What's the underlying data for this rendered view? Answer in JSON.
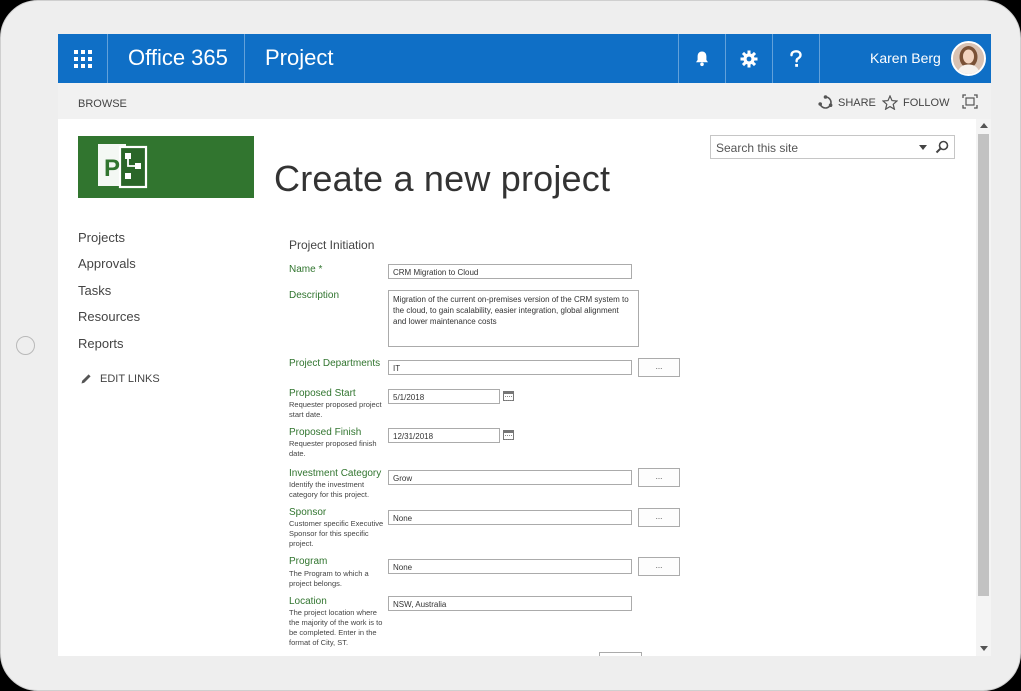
{
  "suitebar": {
    "brand": "Office 365",
    "app": "Project",
    "user": "Karen Berg",
    "icons": [
      "app-launcher-icon",
      "bell-icon",
      "gear-icon",
      "help-icon"
    ]
  },
  "ribbon": {
    "browse": "BROWSE",
    "share": "SHARE",
    "follow": "FOLLOW"
  },
  "search": {
    "placeholder": "Search this site"
  },
  "page": {
    "title": "Create a new project"
  },
  "quicklaunch": {
    "items": [
      "Projects",
      "Approvals",
      "Tasks",
      "Resources",
      "Reports"
    ],
    "edit_links": "EDIT LINKS"
  },
  "form": {
    "section": "Project Initiation",
    "ellipsis": "...",
    "fields": {
      "name": {
        "label": "Name *",
        "value": "CRM Migration to Cloud"
      },
      "description": {
        "label": "Description",
        "value": "Migration of the current on-premises version of the CRM system to the cloud, to gain scalability, easier integration, global alignment and lower maintenance costs"
      },
      "departments": {
        "label": "Project Departments",
        "value": "IT"
      },
      "start": {
        "label": "Proposed Start",
        "desc": "Requester proposed project start date.",
        "value": "5/1/2018"
      },
      "finish": {
        "label": "Proposed Finish",
        "desc": "Requester proposed finish date.",
        "value": "12/31/2018"
      },
      "investment": {
        "label": "Investment Category",
        "desc": "Identify the investment category for this project.",
        "value": "Grow"
      },
      "sponsor": {
        "label": "Sponsor",
        "desc": "Customer specific Executive Sponsor for this specific project.",
        "value": "None"
      },
      "program": {
        "label": "Program",
        "desc": "The Program to which a project belongs.",
        "value": "None"
      },
      "location": {
        "label": "Location",
        "desc": "The project location where the majority of the work is to be completed. Enter in the format of City, ST.",
        "value": "NSW, Australia"
      }
    }
  },
  "colors": {
    "suitebar": "#0f6fc6",
    "accent_green": "#31752f",
    "ribbon": "#f1f1f1"
  }
}
